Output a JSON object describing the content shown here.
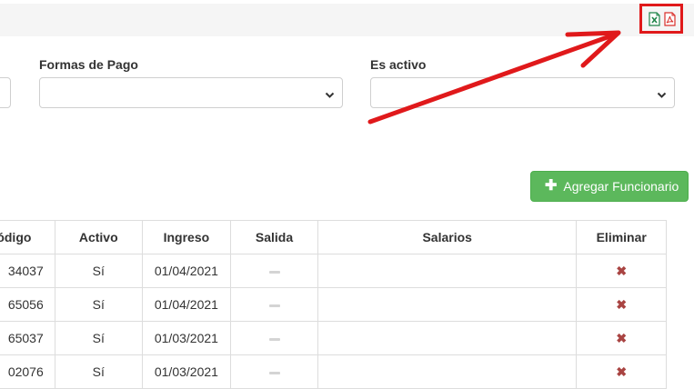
{
  "export": {
    "excel_icon": "excel-icon",
    "pdf_icon": "pdf-icon"
  },
  "filters": {
    "formas_pago": {
      "label": "Formas de Pago",
      "value": ""
    },
    "es_activo": {
      "label": "Es activo",
      "value": ""
    }
  },
  "actions": {
    "add_icon": "plus-icon",
    "add_label": "Agregar Funcionario"
  },
  "table": {
    "headers": [
      "ódigo",
      "Activo",
      "Ingreso",
      "Salida",
      "Salarios",
      "Eliminar"
    ],
    "rows": [
      {
        "codigo": "34037",
        "activo": "Sí",
        "ingreso": "01/04/2021",
        "salida": "",
        "salarios": "",
        "eliminar": "✖"
      },
      {
        "codigo": "65056",
        "activo": "Sí",
        "ingreso": "01/04/2021",
        "salida": "",
        "salarios": "",
        "eliminar": "✖"
      },
      {
        "codigo": "65037",
        "activo": "Sí",
        "ingreso": "01/03/2021",
        "salida": "",
        "salarios": "",
        "eliminar": "✖"
      },
      {
        "codigo": "02076",
        "activo": "Sí",
        "ingreso": "01/03/2021",
        "salida": "",
        "salarios": "",
        "eliminar": "✖"
      }
    ]
  },
  "annotation": {
    "color": "#e0191b"
  }
}
